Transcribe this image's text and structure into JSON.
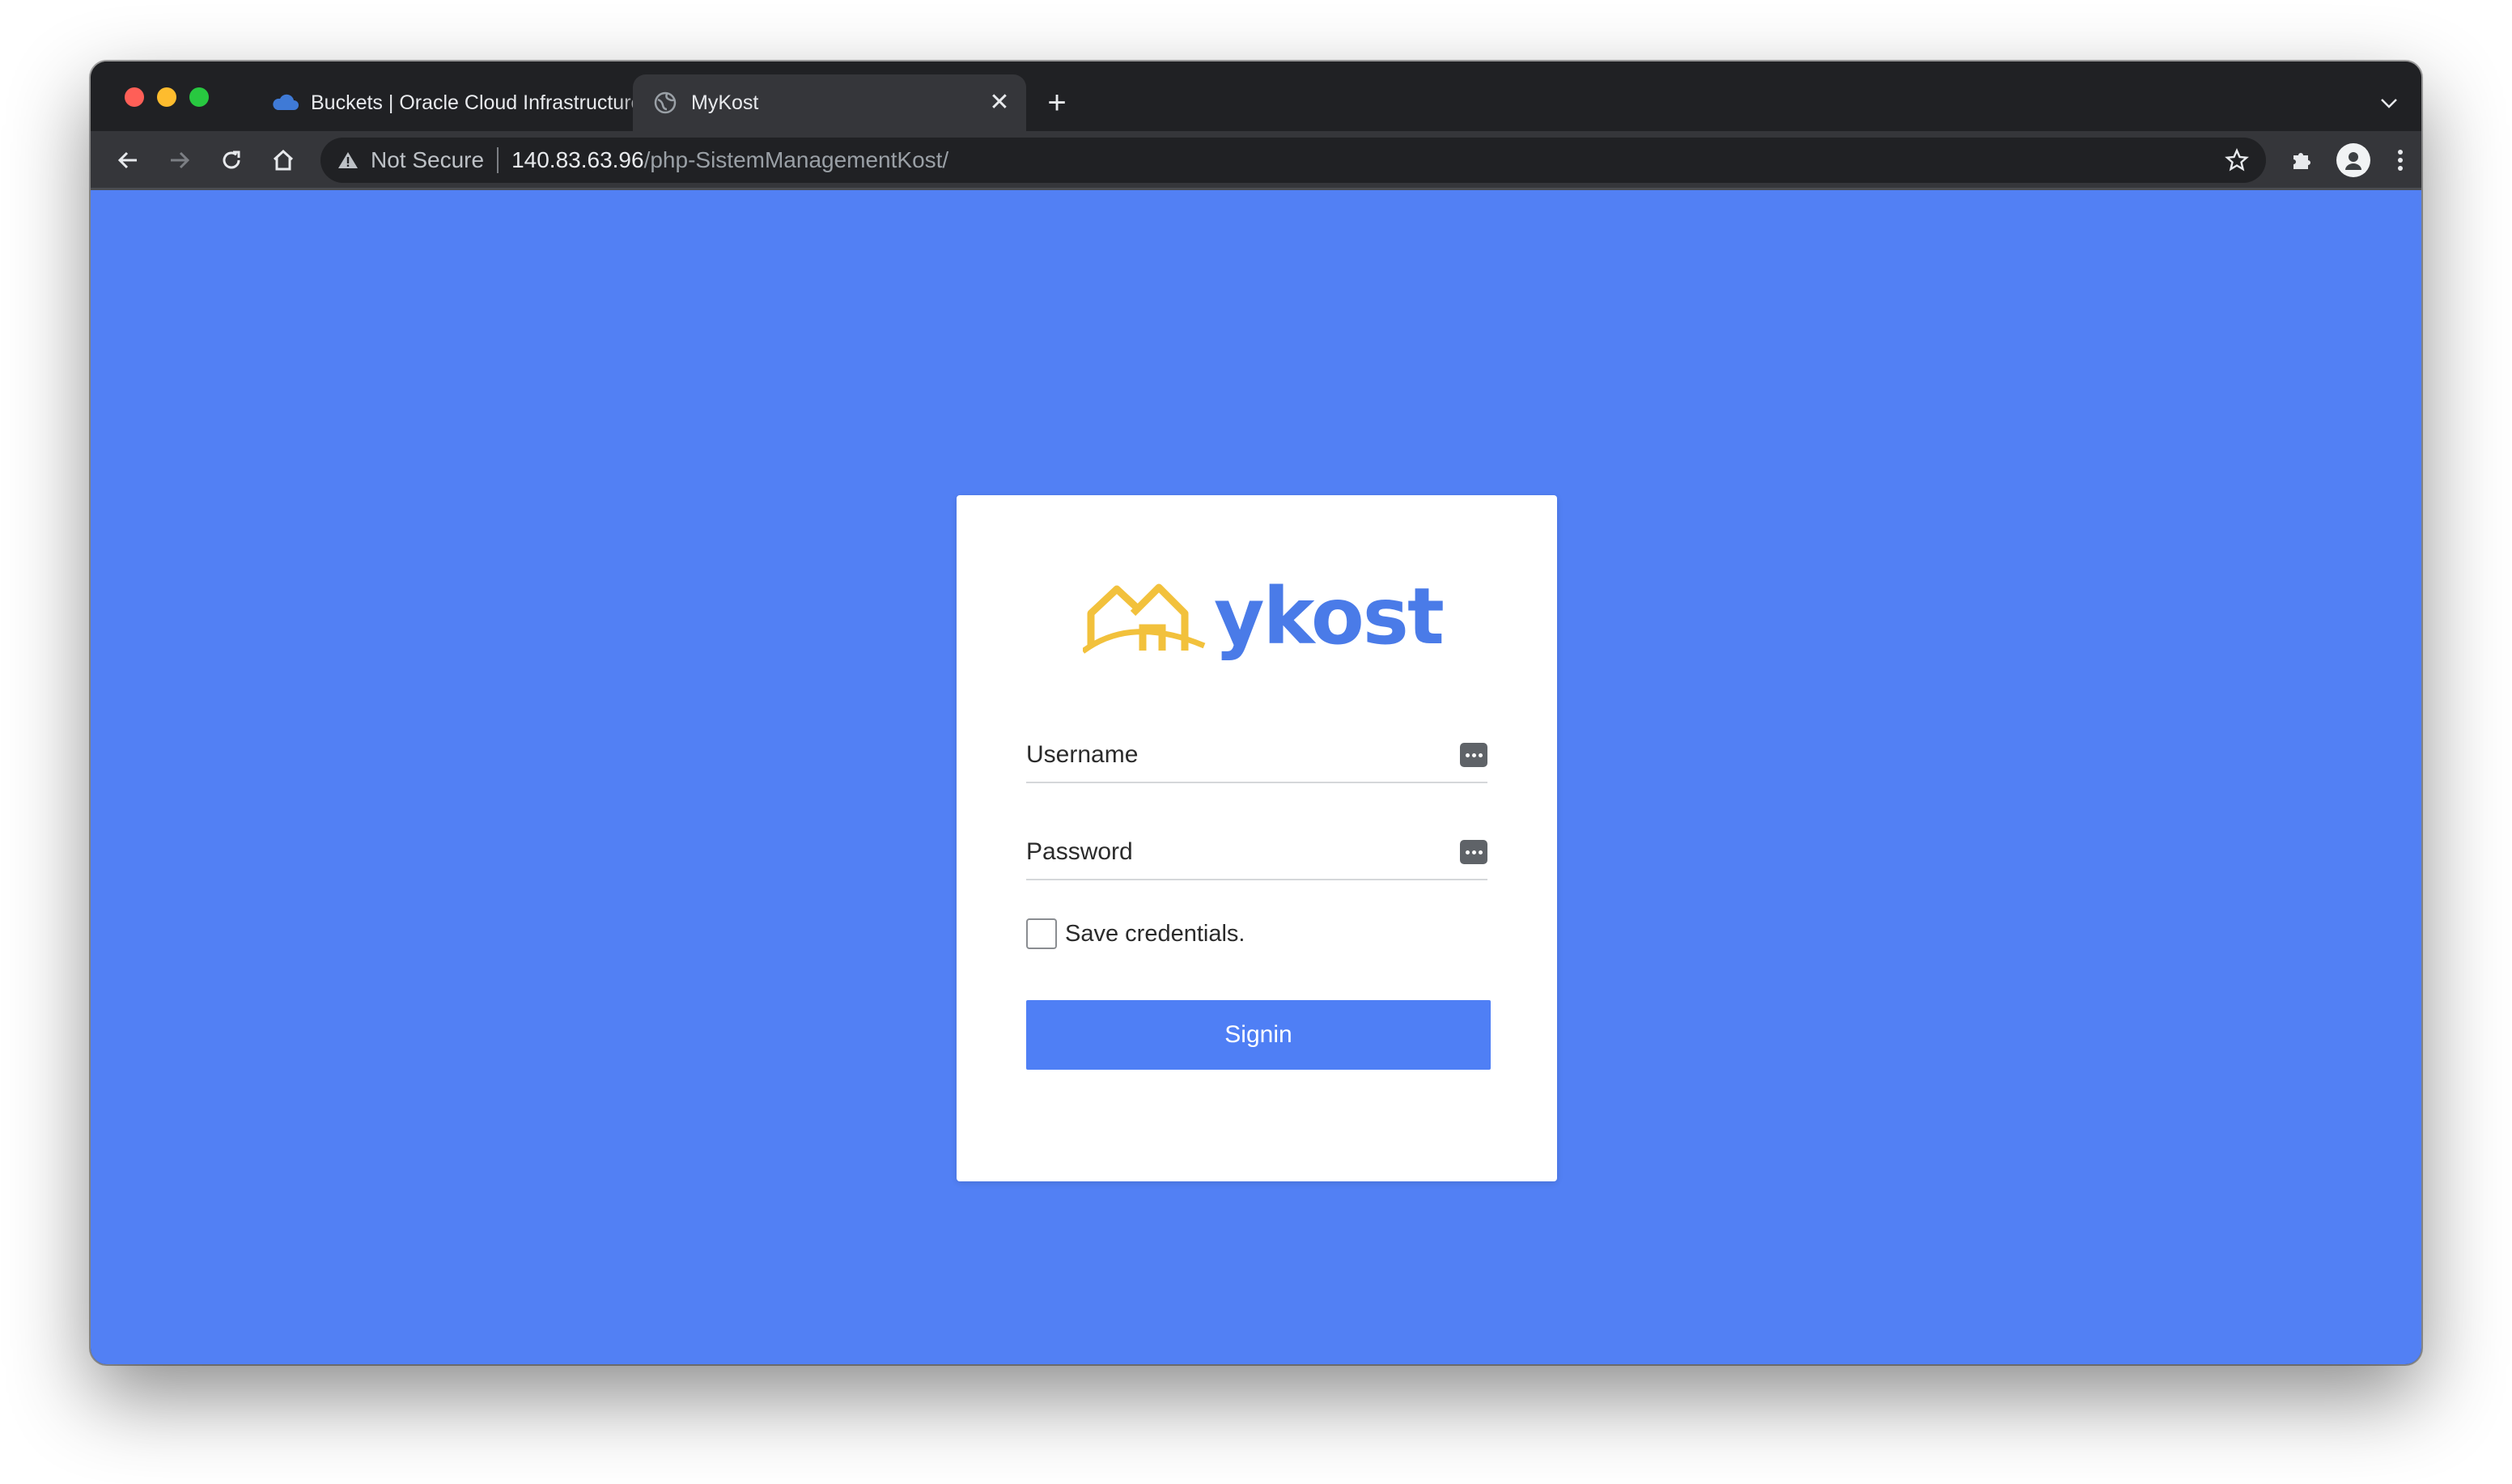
{
  "browser": {
    "tabs": [
      {
        "title": "Buckets | Oracle Cloud Infrastructure",
        "active": false,
        "favicon": "cloud-icon"
      },
      {
        "title": "MyKost",
        "active": true,
        "favicon": "globe-icon"
      }
    ],
    "new_tab_label": "+",
    "tab_close_label": "✕",
    "address_bar": {
      "security_label": "Not Secure",
      "host": "140.83.63.96",
      "path": "/php-SistemManagementKost/"
    }
  },
  "login": {
    "logo_text": "ykost",
    "username_placeholder": "Username",
    "password_placeholder": "Password",
    "remember_label": "Save credentials.",
    "signin_label": "Signin"
  },
  "colors": {
    "page_background": "#5280f4",
    "accent": "#4f7ff5",
    "logo_blue": "#4a7be8",
    "logo_yellow": "#f2c13c"
  }
}
